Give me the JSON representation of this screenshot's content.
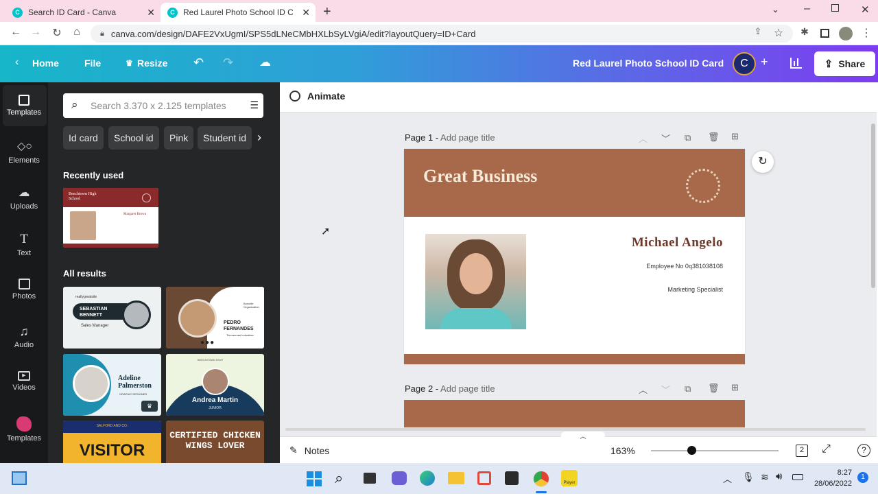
{
  "browser": {
    "tabs": [
      {
        "title": "Search ID Card - Canva"
      },
      {
        "title": "Red Laurel Photo School ID Card"
      }
    ],
    "url": "canva.com/design/DAFE2VxUgmI/SPS5dLNeCMbHXLbSyLVgiA/edit?layoutQuery=ID+Card"
  },
  "header": {
    "home": "Home",
    "file": "File",
    "resize": "Resize",
    "doc_title": "Red Laurel Photo School ID Card",
    "avatar_letter": "C",
    "share": "Share"
  },
  "rail": {
    "items": [
      "Templates",
      "Elements",
      "Uploads",
      "Text",
      "Photos",
      "Audio",
      "Videos",
      "Templates"
    ]
  },
  "panel": {
    "search_placeholder": "Search 3.370 x 2.125 templates",
    "chips": [
      "Id card",
      "School id",
      "Pink",
      "Student id"
    ],
    "recent_label": "Recently used",
    "all_label": "All results",
    "recent_thumb": {
      "school": "Beechtown High School",
      "name": "Margaret Brown"
    },
    "results": [
      {
        "name": "SEBASTIAN BENNETT",
        "role": "Sales Manager",
        "brand": "reallygreatsite"
      },
      {
        "name": "PEDRO FERNANDES",
        "role": "Timmerman Industries",
        "brand": "Borcelle Organization"
      },
      {
        "name": "Adeline Palmerston",
        "role": "GRAPHIC DESIGNER"
      },
      {
        "name": "Andrea Martin",
        "role": "JUNIOR",
        "school": "BEECHTOWN HIGH"
      },
      {
        "name": "VISITOR",
        "role": "SALFORD AND CO."
      },
      {
        "name": "CERTIFIED CHICKEN WINGS LOVER"
      }
    ]
  },
  "editor": {
    "animate": "Animate",
    "page1_label": "Page 1 - ",
    "page2_label": "Page 2 - ",
    "add_title": "Add page title",
    "card": {
      "company": "Great Business",
      "name": "Michael Angelo",
      "employee_no": "Employee No 0q381038108",
      "position": "Marketing Specialist"
    },
    "notes": "Notes",
    "zoom": "163%",
    "page_count": "2"
  },
  "taskbar": {
    "time": "8:27",
    "date": "28/06/2022",
    "notif_count": "1"
  },
  "colors": {
    "card_brown": "#a8694a",
    "name_color": "#6b3a2a",
    "panel_bg": "#252627",
    "rail_bg": "#18191b"
  }
}
